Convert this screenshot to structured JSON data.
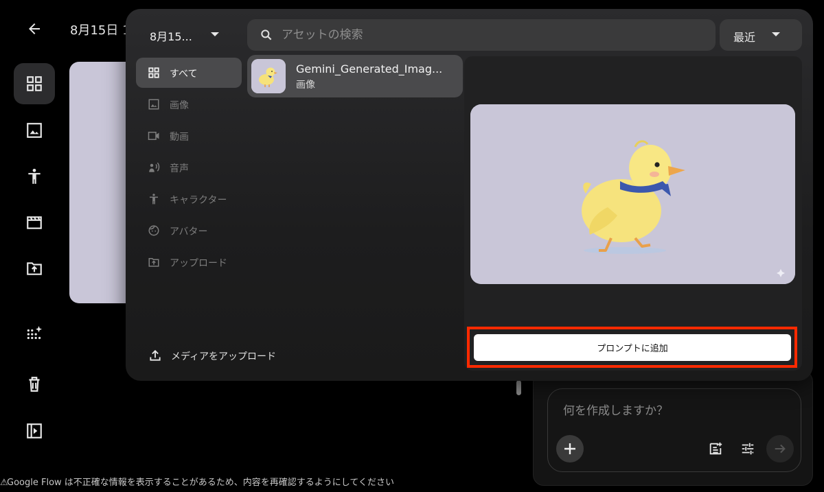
{
  "header": {
    "back_icon": "arrow-back-icon",
    "project_title": "8月15日 1"
  },
  "rail": {
    "items": [
      {
        "name": "rail-all-assets-button",
        "icon": "grid-view-icon",
        "active": true
      },
      {
        "name": "rail-images-button",
        "icon": "image-icon",
        "active": false
      },
      {
        "name": "rail-characters-button",
        "icon": "person-icon",
        "active": false
      },
      {
        "name": "rail-scenes-button",
        "icon": "clapperboard-icon",
        "active": false
      },
      {
        "name": "rail-upload-folder-button",
        "icon": "folder-upload-icon",
        "active": false
      },
      {
        "name": "rail-generate-button",
        "icon": "sparkle-grid-icon",
        "active": false
      },
      {
        "name": "rail-trash-button",
        "icon": "trash-icon",
        "active": false
      },
      {
        "name": "rail-panel-toggle-button",
        "icon": "side-panel-icon",
        "active": false
      }
    ]
  },
  "asset_panel": {
    "project_selector": "8月15...",
    "search": {
      "placeholder": "アセットの検索"
    },
    "sort": {
      "label": "最近"
    },
    "categories": [
      {
        "label": "すべて",
        "icon": "grid-view-icon",
        "active": true
      },
      {
        "label": "画像",
        "icon": "image-icon",
        "active": false
      },
      {
        "label": "動画",
        "icon": "video-camera-icon",
        "active": false
      },
      {
        "label": "音声",
        "icon": "voice-icon",
        "active": false
      },
      {
        "label": "キャラクター",
        "icon": "person-icon",
        "active": false
      },
      {
        "label": "アバター",
        "icon": "face-icon",
        "active": false
      },
      {
        "label": "アップロード",
        "icon": "folder-upload-icon",
        "active": false
      }
    ],
    "upload_label": "メディアをアップロード",
    "assets": [
      {
        "name": "Gemini_Generated_Imag...",
        "type": "画像"
      }
    ],
    "preview": {
      "add_to_prompt_label": "プロンプトに追加"
    }
  },
  "prompt": {
    "placeholder": "何を作成しますか？"
  },
  "footer": {
    "disclaimer": "Google Flow は不正確な情報を表示することがあるため、内容を再確認するようにしてください"
  },
  "colors": {
    "highlight": "#ff2a00",
    "image_bg": "#c9c6d8",
    "panel_bg": "#2b2b2d"
  }
}
